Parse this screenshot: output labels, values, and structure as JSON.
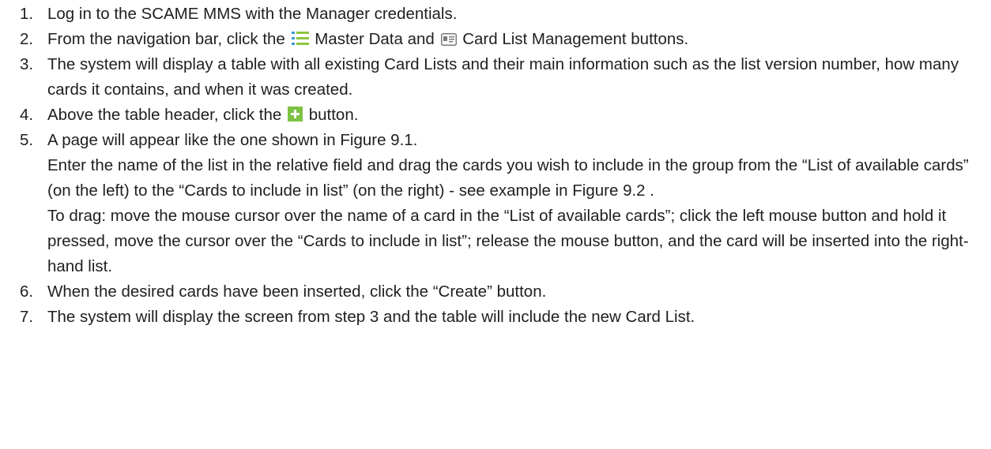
{
  "steps": [
    {
      "number": "1.",
      "text": "Log in to the SCAME MMS with the Manager credentials."
    },
    {
      "number": "2.",
      "before": "From the navigation bar, click the",
      "icon1": "list-icon",
      "mid": "Master Data and",
      "icon2": "card-icon",
      "after": "Card List Management buttons."
    },
    {
      "number": "3.",
      "text": "The system will display a table with all existing Card Lists and their main information such as the list version number, how many cards it contains, and when it was created."
    },
    {
      "number": "4.",
      "before": "Above the table header, click the",
      "icon": "plus-icon",
      "after": "button."
    },
    {
      "number": "5.",
      "text": "A page will appear like the one shown in Figure 9.1.",
      "para2": "Enter the name of the list in the relative field and drag the cards you wish to include in the group from the “List of available cards” (on the left) to the “Cards to include in list” (on the right) - see example in Figure 9.2 .",
      "para3": "To drag: move the mouse cursor over the name of a card in the “List of available cards”; click the left mouse button and hold it pressed, move the cursor over the “Cards to include in list”; release the mouse button, and the card will be inserted into the right-hand list."
    },
    {
      "number": "6.",
      "text": "When the desired cards have been inserted, click the “Create” button."
    },
    {
      "number": "7.",
      "text": "The system will display the screen from step 3 and the table will include the new Card List."
    }
  ],
  "colors": {
    "list_icon_bars": "#8cc63f",
    "list_icon_dots": "#3b9ad9",
    "plus_icon_bg": "#7dc242",
    "card_icon": "#7a7a7a"
  }
}
